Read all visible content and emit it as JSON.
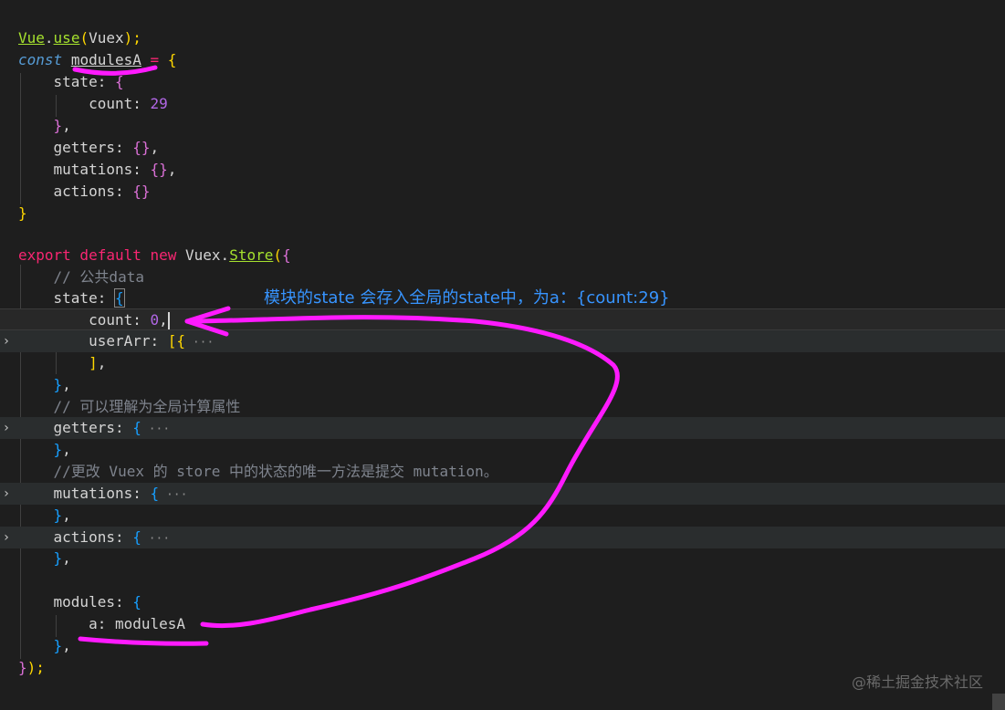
{
  "editor": {
    "lines": {
      "l1_a": "Vue",
      "l1_b": ".",
      "l1_c": "use",
      "l1_d": "(",
      "l1_e": "Vuex",
      "l1_f": ");",
      "l2_kw": "const",
      "l2_name": "modulesA",
      "l2_eq": " = ",
      "l2_br": "{",
      "l3_key": "state: ",
      "l3_br": "{",
      "l4_key": "count: ",
      "l4_val": "29",
      "l5_br": "}",
      "l5_comma": ",",
      "l6_key": "getters: ",
      "l6_br": "{}",
      "l6_comma": ",",
      "l7_key": "mutations: ",
      "l7_br": "{}",
      "l7_comma": ",",
      "l8_key": "actions: ",
      "l8_br": "{}",
      "l9_br": "}",
      "l11_export": "export",
      "l11_default": " default",
      "l11_new": " new",
      "l11_vuex": " Vuex.",
      "l11_store": "Store",
      "l11_paren": "(",
      "l11_br": "{",
      "l12_cm": "// 公共data",
      "l13_key": "state: ",
      "l13_br": "{",
      "l14_key": "count: ",
      "l14_val": "0",
      "l14_comma": ",",
      "l15_key": "userArr: ",
      "l15_br": "[{",
      "l15_ell": " ···",
      "l16_br": "]",
      "l16_comma": ",",
      "l17_br": "}",
      "l17_comma": ",",
      "l18_cm": "// 可以理解为全局计算属性",
      "l19_key": "getters: ",
      "l19_br": "{",
      "l19_ell": " ···",
      "l20_br": "}",
      "l20_comma": ",",
      "l21_cm": "//更改 Vuex 的 store 中的状态的唯一方法是提交 mutation。",
      "l22_key": "mutations: ",
      "l22_br": "{",
      "l22_ell": " ···",
      "l23_br": "}",
      "l23_comma": ",",
      "l24_key": "actions: ",
      "l24_br": "{",
      "l24_ell": " ···",
      "l25_br": "}",
      "l25_comma": ",",
      "l27_key": "modules: ",
      "l27_br": "{",
      "l28_key": "a: ",
      "l28_val": "modulesA",
      "l29_br": "}",
      "l29_comma": ",",
      "l30_br": "}",
      "l30_paren": ");"
    },
    "fold_glyph": "›"
  },
  "annotation": {
    "text": "模块的state 会存入全局的state中，为a：{count:29}",
    "ink_color": "#ff1aff",
    "text_color": "#3794ff"
  },
  "watermark": "@稀土掘金技术社区"
}
